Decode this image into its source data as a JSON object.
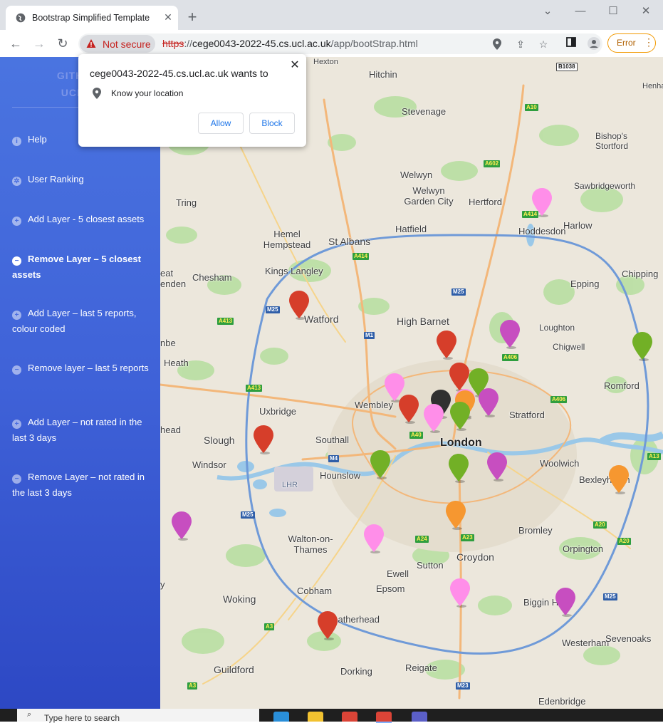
{
  "browser": {
    "tab_title": "Bootstrap Simplified Template",
    "security_label": "Not secure",
    "url_scheme": "https",
    "url_host": "cege0043-2022-45.cs.ucl.ac.uk",
    "url_path": "/app/bootStrap.html",
    "error_label": "Error"
  },
  "popup": {
    "title": "cege0043-2022-45.cs.ucl.ac.uk wants to",
    "permission": "Know your location",
    "allow": "Allow",
    "block": "Block"
  },
  "sidebar": {
    "brand_line1": "GITHUB:",
    "brand_line2": "UCL: U",
    "items": [
      {
        "label": "Help",
        "icon": "info-icon"
      },
      {
        "label": "User Ranking",
        "icon": "gear-icon"
      },
      {
        "label": "Add Layer - 5 closest assets",
        "icon": "plus-circle-icon"
      },
      {
        "label": "Remove Layer – 5 closest assets",
        "icon": "minus-circle-icon"
      },
      {
        "label": "Add Layer – last 5 reports, colour coded",
        "icon": "plus-circle-icon"
      },
      {
        "label": "Remove layer – last 5 reports",
        "icon": "minus-circle-icon"
      },
      {
        "label": "Add Layer – not rated in the last 3 days",
        "icon": "plus-circle-icon"
      },
      {
        "label": "Remove Layer – not rated in the last 3 days",
        "icon": "minus-circle-icon"
      }
    ]
  },
  "map": {
    "places": [
      "Hexton",
      "Hitchin",
      "Stevenage",
      "Henham",
      "Bishop's Stortford",
      "Welwyn",
      "Welwyn Garden City",
      "Hertford",
      "Sawbridgeworth",
      "Tring",
      "Hoddesdon",
      "Harlow",
      "Hemel Hempstead",
      "St Albans",
      "Hatfield",
      "Chesham",
      "Kings Langley",
      "Epping",
      "Chipping",
      "Watford",
      "High Barnet",
      "Loughton",
      "Chigwell",
      "Romford",
      "Wembley",
      "Uxbridge",
      "Stratford",
      "Slough",
      "Southall",
      "London",
      "Windsor",
      "Hounslow",
      "Woolwich",
      "Bexleyheath",
      "LHR",
      "Walton-on-Thames",
      "Bromley",
      "Orpington",
      "Croydon",
      "Sutton",
      "Ewell",
      "Epsom",
      "Cobham",
      "Woking",
      "Biggin Hill",
      "Leatherhead",
      "Westerham",
      "Sevenoaks",
      "Guildford",
      "Dorking",
      "Reigate",
      "Edenbridge",
      "eat",
      "enden",
      "nbe",
      "Heath",
      "head",
      "y"
    ],
    "roads": [
      "B1038",
      "A10",
      "A602",
      "A414",
      "A414",
      "M25",
      "A413",
      "M1",
      "A406",
      "A406",
      "M25",
      "A413",
      "A40",
      "M4",
      "M25",
      "A24",
      "A23",
      "A20",
      "A20",
      "M25",
      "A3",
      "A3",
      "M23",
      "A13"
    ],
    "marker_colors": {
      "red": "#d63e2a",
      "green": "#72b026",
      "pink": "#ff8ee9",
      "magenta": "#c74ec0",
      "orange": "#f69730",
      "black": "#303030"
    }
  },
  "taskbar": {
    "search_placeholder": "Type here to search"
  }
}
